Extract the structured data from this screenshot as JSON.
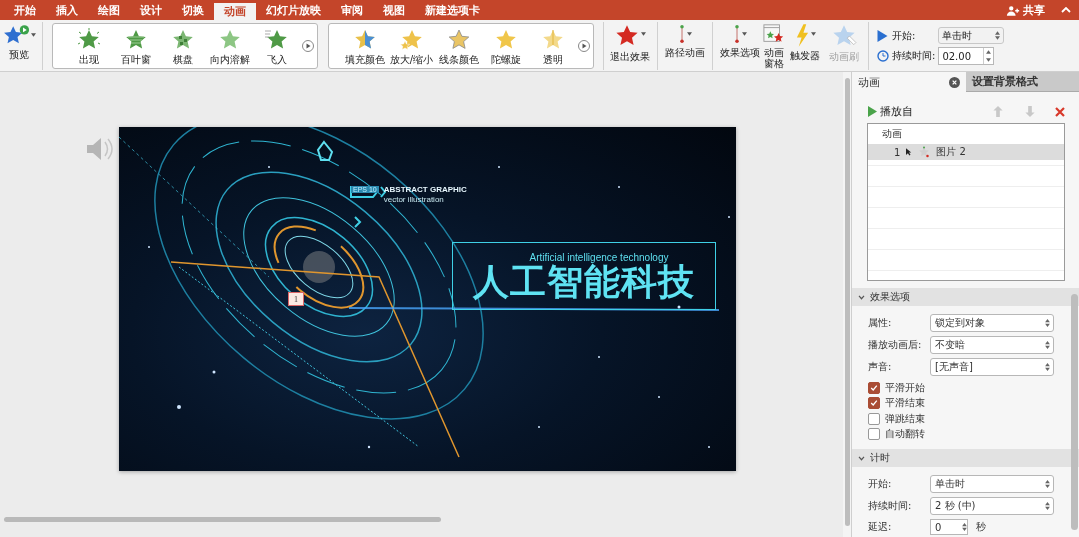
{
  "ribbon_tabs": [
    {
      "label": "开始",
      "selected": false
    },
    {
      "label": "插入",
      "selected": false
    },
    {
      "label": "绘图",
      "selected": false
    },
    {
      "label": "设计",
      "selected": false
    },
    {
      "label": "切换",
      "selected": false
    },
    {
      "label": "动画",
      "selected": true
    },
    {
      "label": "幻灯片放映",
      "selected": false
    },
    {
      "label": "审阅",
      "selected": false
    },
    {
      "label": "视图",
      "selected": false
    },
    {
      "label": "新建选项卡",
      "selected": false
    }
  ],
  "share": {
    "label": "共享"
  },
  "ribbon": {
    "preview": {
      "label": "预览"
    },
    "entrance_gallery": [
      {
        "label": "出现",
        "kind": "appear"
      },
      {
        "label": "百叶窗",
        "kind": "blinds"
      },
      {
        "label": "棋盘",
        "kind": "checker"
      },
      {
        "label": "向内溶解",
        "kind": "dissolve"
      },
      {
        "label": "飞入",
        "kind": "fly"
      }
    ],
    "emphasis_gallery": [
      {
        "label": "填充颜色",
        "kind": "fill"
      },
      {
        "label": "放大/缩小",
        "kind": "grow"
      },
      {
        "label": "线条颜色",
        "kind": "line"
      },
      {
        "label": "陀螺旋",
        "kind": "spin"
      },
      {
        "label": "透明",
        "kind": "transparency"
      }
    ],
    "commands": [
      {
        "label": "退出效果",
        "kind": "exit",
        "disabled": false
      },
      {
        "label": "路径动画",
        "kind": "path",
        "disabled": false
      },
      {
        "label": "效果选项",
        "kind": "options",
        "disabled": false
      },
      {
        "label": "动画窗格",
        "kind": "pane",
        "disabled": false
      },
      {
        "label": "触发器",
        "kind": "trigger",
        "disabled": false
      },
      {
        "label": "动画刷",
        "kind": "painter",
        "disabled": true
      }
    ],
    "timing": {
      "start_label": "开始:",
      "start_value": "单击时",
      "duration_label": "持续时间:",
      "duration_value": "02.00"
    }
  },
  "slide": {
    "subtitle": "Artificial intelligence technology",
    "title": "人工智能科技",
    "graphic_title": "ABSTRACT GRAPHIC",
    "graphic_subtitle": "vector illustration",
    "badge": "EPS 10",
    "animation_tag": "1"
  },
  "pane": {
    "tabs": [
      {
        "label": "动画",
        "selected": true
      },
      {
        "label": "设置背景格式",
        "selected": false
      }
    ],
    "play_button": "播放自",
    "list": {
      "header": "动画",
      "rows": [
        {
          "index": "1",
          "name": "图片 2",
          "selected": true
        }
      ]
    },
    "sections": [
      {
        "title": "效果选项",
        "expanded": true,
        "fields": [
          {
            "label": "属性:",
            "value": "锁定到对象"
          },
          {
            "label": "播放动画后:",
            "value": "不变暗"
          },
          {
            "label": "声音:",
            "value": "[无声音]"
          }
        ],
        "checkboxes": [
          {
            "label": "平滑开始",
            "checked": true
          },
          {
            "label": "平滑结束",
            "checked": true
          },
          {
            "label": "弹跳结束",
            "checked": false
          },
          {
            "label": "自动翻转",
            "checked": false
          }
        ]
      },
      {
        "title": "计时",
        "expanded": true,
        "fields": [
          {
            "label": "开始:",
            "value": "单击时"
          },
          {
            "label": "持续时间:",
            "value": "2 秒 (中)"
          }
        ],
        "spinner": {
          "label": "延迟:",
          "value": "0",
          "unit": "秒"
        }
      }
    ]
  }
}
